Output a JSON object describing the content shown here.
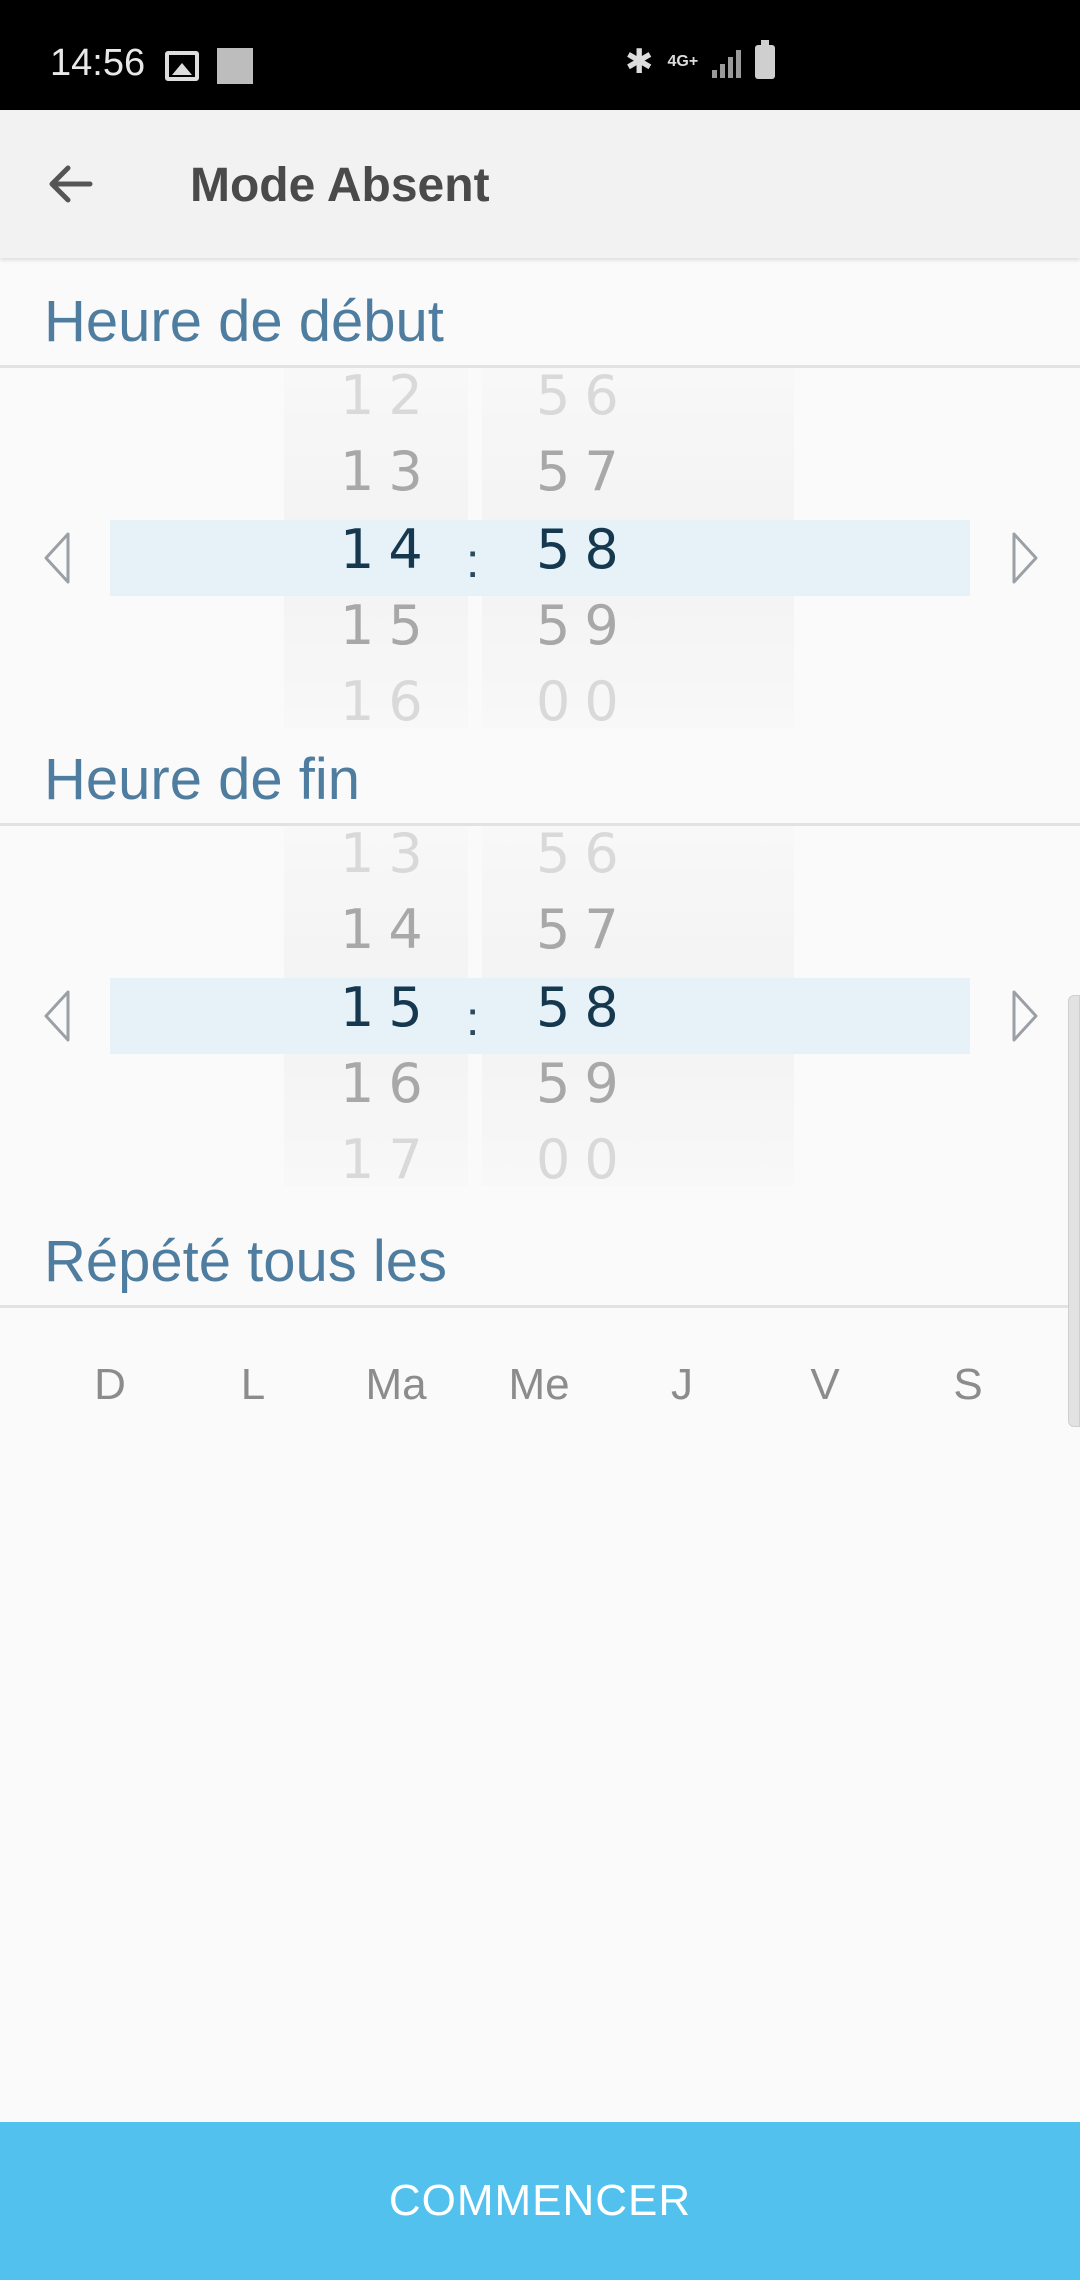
{
  "status_bar": {
    "time": "14:56",
    "network": "4G+",
    "icons": [
      "image-icon",
      "square-notification-icon",
      "bluetooth-icon",
      "network-icon",
      "signal-icon",
      "battery-icon"
    ]
  },
  "app_bar": {
    "title": "Mode Absent",
    "back_icon": "arrow-left-icon"
  },
  "start_time": {
    "label": "Heure de début",
    "hours": [
      "12",
      "13",
      "14",
      "15",
      "16"
    ],
    "minutes": [
      "56",
      "57",
      "58",
      "59",
      "00"
    ],
    "separator": ":"
  },
  "end_time": {
    "label": "Heure de fin",
    "hours": [
      "13",
      "14",
      "15",
      "16",
      "17"
    ],
    "minutes": [
      "56",
      "57",
      "58",
      "59",
      "00"
    ],
    "separator": ":"
  },
  "repeat": {
    "label": "Répété tous les",
    "days": [
      "D",
      "L",
      "Ma",
      "Me",
      "J",
      "V",
      "S"
    ]
  },
  "start_button": {
    "label": "COMMENCER"
  },
  "colors": {
    "accent": "#52c1ee",
    "section_title": "#4f7da0",
    "selected_row": "#e6f1f8",
    "selected_text": "#15384f"
  }
}
